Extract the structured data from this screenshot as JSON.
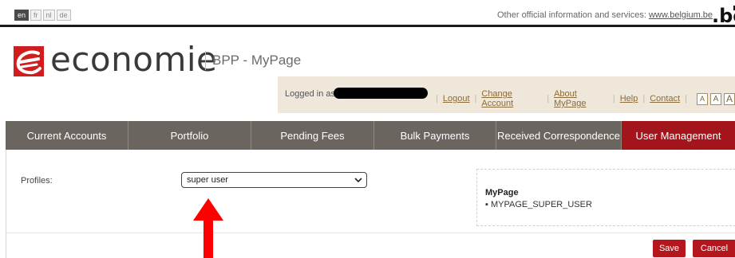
{
  "languages": [
    {
      "code": "en",
      "active": true
    },
    {
      "code": "fr",
      "active": false
    },
    {
      "code": "nl",
      "active": false
    },
    {
      "code": "de",
      "active": false
    }
  ],
  "topbar": {
    "official_text": "Other official information and services:",
    "official_link": "www.belgium.be",
    "be_logo_text": ".be"
  },
  "header": {
    "brand": "economie",
    "app_name": "BPP - MyPage"
  },
  "userbar": {
    "logged_in_label": "Logged in as:",
    "links": [
      "Logout",
      "Change Account",
      "About MyPage",
      "Help",
      "Contact"
    ],
    "font_buttons": [
      "A",
      "A",
      "A"
    ]
  },
  "nav": {
    "tabs": [
      {
        "label": "Current Accounts",
        "active": false
      },
      {
        "label": "Portfolio",
        "active": false
      },
      {
        "label": "Pending Fees",
        "active": false
      },
      {
        "label": "Bulk Payments",
        "active": false
      },
      {
        "label": "Received Correspondence",
        "active": false
      },
      {
        "label": "User Management",
        "active": true
      }
    ]
  },
  "content": {
    "profiles_label": "Profiles:",
    "profile_selected": "super user",
    "permissions_title": "MyPage",
    "permissions": [
      "MYPAGE_SUPER_USER"
    ],
    "save_label": "Save",
    "cancel_label": "Cancel"
  },
  "colors": {
    "accent_red": "#a4141b",
    "nav_gray": "#6a655e",
    "userbar_bg": "#eee7da",
    "arrow_red": "#ff0000"
  }
}
